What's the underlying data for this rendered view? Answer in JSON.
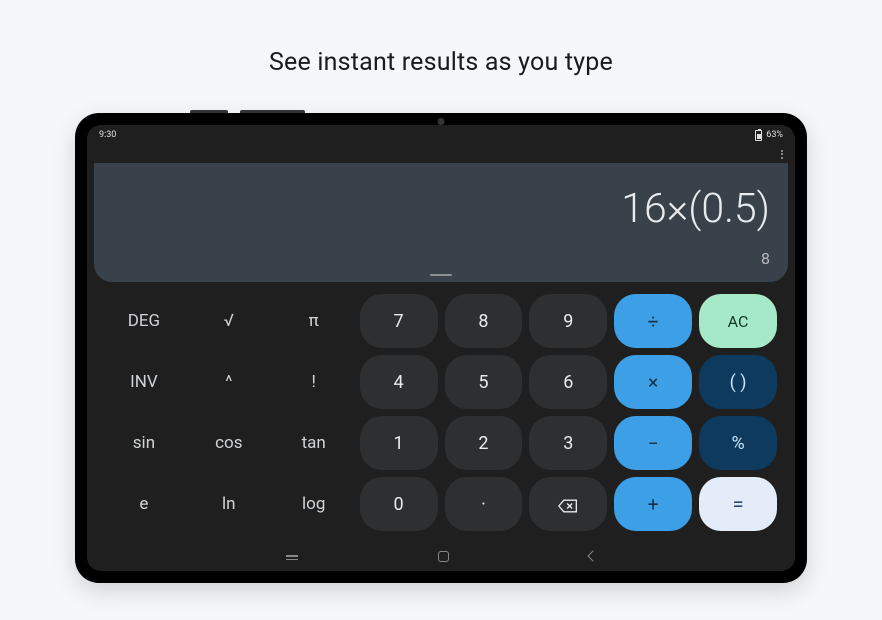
{
  "tagline": "See instant results as you type",
  "status": {
    "time": "9:30",
    "battery": "63%"
  },
  "calculator": {
    "expression": "16×(0.5)",
    "result": "8"
  },
  "keys": {
    "deg": "DEG",
    "sqrt": "√",
    "pi": "π",
    "inv": "INV",
    "pow": "^",
    "fact": "!",
    "sin": "sin",
    "cos": "cos",
    "tan": "tan",
    "e": "e",
    "ln": "ln",
    "log": "log",
    "n7": "7",
    "n8": "8",
    "n9": "9",
    "n4": "4",
    "n5": "5",
    "n6": "6",
    "n1": "1",
    "n2": "2",
    "n3": "3",
    "n0": "0",
    "dot": "·",
    "div": "÷",
    "mul": "×",
    "sub": "−",
    "add": "+",
    "ac": "AC",
    "paren": "( )",
    "pct": "%",
    "eq": "="
  }
}
